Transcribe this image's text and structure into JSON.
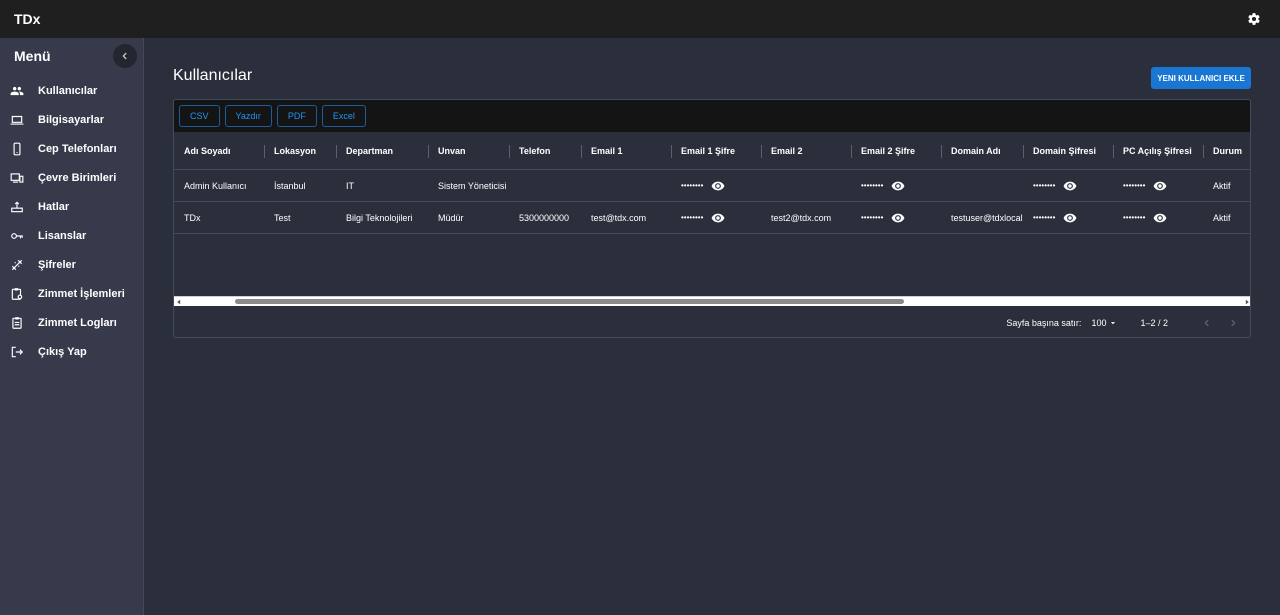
{
  "app": {
    "title": "TDx"
  },
  "sidebar": {
    "title": "Menü",
    "items": [
      {
        "label": "Kullanıcılar",
        "icon": "people-icon"
      },
      {
        "label": "Bilgisayarlar",
        "icon": "laptop-icon"
      },
      {
        "label": "Cep Telefonları",
        "icon": "phone-icon"
      },
      {
        "label": "Çevre Birimleri",
        "icon": "devices-icon"
      },
      {
        "label": "Hatlar",
        "icon": "router-icon"
      },
      {
        "label": "Lisanslar",
        "icon": "key-icon"
      },
      {
        "label": "Şifreler",
        "icon": "password-icon"
      },
      {
        "label": "Zimmet İşlemleri",
        "icon": "clipboard-settings-icon"
      },
      {
        "label": "Zimmet Logları",
        "icon": "clipboard-list-icon"
      },
      {
        "label": "Çıkış Yap",
        "icon": "logout-icon"
      }
    ]
  },
  "main": {
    "title": "Kullanıcılar",
    "add_button": "YENI KULLANICI EKLE",
    "toolbar": [
      "CSV",
      "Yazdır",
      "PDF",
      "Excel"
    ],
    "columns": [
      "Adı Soyadı",
      "Lokasyon",
      "Departman",
      "Unvan",
      "Telefon",
      "Email 1",
      "Email 1 Şifre",
      "Email 2",
      "Email 2 Şifre",
      "Domain Adı",
      "Domain Şifresi",
      "PC Açılış Şifresi",
      "Durum"
    ],
    "rows": [
      [
        "Admin Kullanıcı",
        "İstanbul",
        "IT",
        "Sistem Yöneticisi",
        "",
        "",
        "••••••••",
        "",
        "••••••••",
        "",
        "••••••••",
        "••••••••",
        "Aktif"
      ],
      [
        "TDx",
        "Test",
        "Bilgi Teknolojileri",
        "Müdür",
        "5300000000",
        "test@tdx.com",
        "••••••••",
        "test2@tdx.com",
        "••••••••",
        "testuser@tdxlocal",
        "••••••••",
        "••••••••",
        "Aktif"
      ]
    ],
    "footer": {
      "rows_per_page_label": "Sayfa başına satır:",
      "rows_per_page": "100",
      "range": "1–2 / 2"
    }
  },
  "colors": {
    "accent": "#1976d2",
    "sidebar": "#363a4a",
    "topbar": "#1f1f1f",
    "background": "#2b2f3b"
  }
}
